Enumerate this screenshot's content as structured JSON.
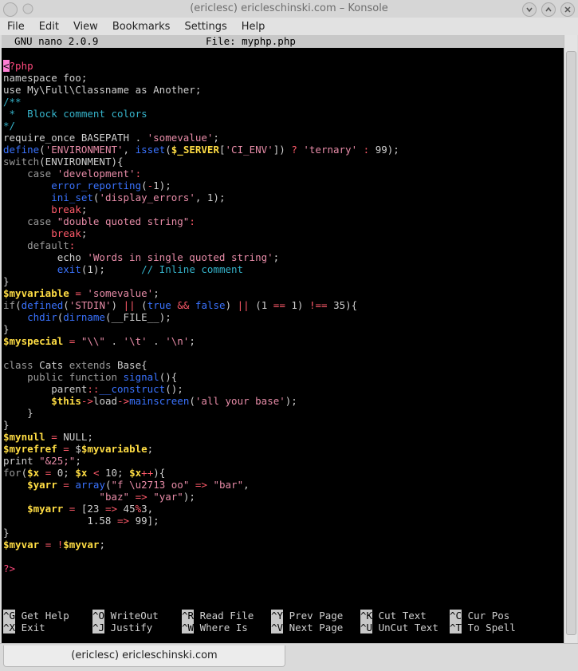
{
  "window": {
    "title": "(ericlesc) ericleschinski.com – Konsole"
  },
  "menu": [
    "File",
    "Edit",
    "View",
    "Bookmarks",
    "Settings",
    "Help"
  ],
  "nano": {
    "version": "GNU nano 2.0.9",
    "file": "File: myphp.php"
  },
  "help_rows": [
    [
      {
        "key": "^G",
        "label": "Get Help"
      },
      {
        "key": "^O",
        "label": "WriteOut"
      },
      {
        "key": "^R",
        "label": "Read File"
      },
      {
        "key": "^Y",
        "label": "Prev Page"
      },
      {
        "key": "^K",
        "label": "Cut Text"
      },
      {
        "key": "^C",
        "label": "Cur Pos"
      }
    ],
    [
      {
        "key": "^X",
        "label": "Exit"
      },
      {
        "key": "^J",
        "label": "Justify"
      },
      {
        "key": "^W",
        "label": "Where Is"
      },
      {
        "key": "^V",
        "label": "Next Page"
      },
      {
        "key": "^U",
        "label": "UnCut Text"
      },
      {
        "key": "^T",
        "label": "To Spell"
      }
    ]
  ],
  "tab": {
    "label": "(ericlesc) ericleschinski.com"
  },
  "code_lines": [
    [
      [
        "cursor",
        "<"
      ],
      [
        "k",
        "?php"
      ]
    ],
    [
      [
        "t",
        "namespace foo;"
      ]
    ],
    [
      [
        "t",
        "use My\\Full\\Classname as Another;"
      ]
    ],
    [
      [
        "c",
        "/**"
      ]
    ],
    [
      [
        "c",
        " *  Block comment colors"
      ]
    ],
    [
      [
        "c",
        "*/"
      ]
    ],
    [
      [
        "t",
        "require_once BASEPATH . "
      ],
      [
        "s",
        "'somevalue'"
      ],
      [
        "t",
        ";"
      ]
    ],
    [
      [
        "f",
        "define"
      ],
      [
        "t",
        "("
      ],
      [
        "s",
        "'ENVIRONMENT'"
      ],
      [
        "t",
        ", "
      ],
      [
        "f",
        "isset"
      ],
      [
        "t",
        "("
      ],
      [
        "v",
        "$_SERVER"
      ],
      [
        "t",
        "["
      ],
      [
        "s",
        "'CI_ENV'"
      ],
      [
        "t",
        "]) "
      ],
      [
        "o",
        "?"
      ],
      [
        "t",
        " "
      ],
      [
        "s",
        "'ternary'"
      ],
      [
        "t",
        " "
      ],
      [
        "o",
        ":"
      ],
      [
        "t",
        " 99);"
      ]
    ],
    [
      [
        "kw",
        "switch"
      ],
      [
        "t",
        "(ENVIRONMENT){"
      ]
    ],
    [
      [
        "t",
        "    "
      ],
      [
        "kw",
        "case"
      ],
      [
        "t",
        " "
      ],
      [
        "s",
        "'development'"
      ],
      [
        "o",
        ":"
      ]
    ],
    [
      [
        "t",
        "        "
      ],
      [
        "f",
        "error_reporting"
      ],
      [
        "t",
        "("
      ],
      [
        "o",
        "-"
      ],
      [
        "t",
        "1);"
      ]
    ],
    [
      [
        "t",
        "        "
      ],
      [
        "f",
        "ini_set"
      ],
      [
        "t",
        "("
      ],
      [
        "s",
        "'display_errors'"
      ],
      [
        "t",
        ", 1);"
      ]
    ],
    [
      [
        "t",
        "        "
      ],
      [
        "br",
        "break"
      ],
      [
        "t",
        ";"
      ]
    ],
    [
      [
        "t",
        "    "
      ],
      [
        "kw",
        "case"
      ],
      [
        "t",
        " "
      ],
      [
        "s",
        "\"double quoted string\""
      ],
      [
        "o",
        ":"
      ]
    ],
    [
      [
        "t",
        "        "
      ],
      [
        "br",
        "break"
      ],
      [
        "t",
        ";"
      ]
    ],
    [
      [
        "t",
        "    "
      ],
      [
        "kw",
        "default"
      ],
      [
        "o",
        ":"
      ]
    ],
    [
      [
        "t",
        "         echo "
      ],
      [
        "s",
        "'Words in single quoted string'"
      ],
      [
        "t",
        ";"
      ]
    ],
    [
      [
        "t",
        "         "
      ],
      [
        "f",
        "exit"
      ],
      [
        "t",
        "(1);      "
      ],
      [
        "c",
        "// Inline comment"
      ]
    ],
    [
      [
        "t",
        "}"
      ]
    ],
    [
      [
        "v",
        "$myvariable"
      ],
      [
        "t",
        " "
      ],
      [
        "o",
        "="
      ],
      [
        "t",
        " "
      ],
      [
        "s",
        "'somevalue'"
      ],
      [
        "t",
        ";"
      ]
    ],
    [
      [
        "kw",
        "if"
      ],
      [
        "t",
        "("
      ],
      [
        "f",
        "defined"
      ],
      [
        "t",
        "("
      ],
      [
        "s",
        "'STDIN'"
      ],
      [
        "t",
        ") "
      ],
      [
        "o",
        "||"
      ],
      [
        "t",
        " ("
      ],
      [
        "f",
        "true"
      ],
      [
        "t",
        " "
      ],
      [
        "o",
        "&&"
      ],
      [
        "t",
        " "
      ],
      [
        "f",
        "false"
      ],
      [
        "t",
        ") "
      ],
      [
        "o",
        "||"
      ],
      [
        "t",
        " (1 "
      ],
      [
        "o",
        "=="
      ],
      [
        "t",
        " 1) "
      ],
      [
        "o",
        "!=="
      ],
      [
        "t",
        " 35){"
      ]
    ],
    [
      [
        "t",
        "    "
      ],
      [
        "f",
        "chdir"
      ],
      [
        "t",
        "("
      ],
      [
        "f",
        "dirname"
      ],
      [
        "t",
        "(__FILE__);"
      ]
    ],
    [
      [
        "t",
        "}"
      ]
    ],
    [
      [
        "v",
        "$myspecial"
      ],
      [
        "t",
        " "
      ],
      [
        "o",
        "="
      ],
      [
        "t",
        " "
      ],
      [
        "s",
        "\"\\\\\""
      ],
      [
        "t",
        " . "
      ],
      [
        "s",
        "'\\t'"
      ],
      [
        "t",
        " . "
      ],
      [
        "s",
        "'\\n'"
      ],
      [
        "t",
        ";"
      ]
    ],
    [
      [
        "t",
        ""
      ]
    ],
    [
      [
        "kw",
        "class"
      ],
      [
        "t",
        " Cats "
      ],
      [
        "kw",
        "extends"
      ],
      [
        "t",
        " Base{"
      ]
    ],
    [
      [
        "t",
        "    "
      ],
      [
        "kw",
        "public function"
      ],
      [
        "t",
        " "
      ],
      [
        "f",
        "signal"
      ],
      [
        "t",
        "(){"
      ]
    ],
    [
      [
        "t",
        "        parent"
      ],
      [
        "o",
        "::"
      ],
      [
        "f",
        "__construct"
      ],
      [
        "t",
        "();"
      ]
    ],
    [
      [
        "t",
        "        "
      ],
      [
        "v",
        "$this"
      ],
      [
        "o",
        "->"
      ],
      [
        "t",
        "load"
      ],
      [
        "o",
        "->"
      ],
      [
        "f",
        "mainscreen"
      ],
      [
        "t",
        "("
      ],
      [
        "s",
        "'all your base'"
      ],
      [
        "t",
        ");"
      ]
    ],
    [
      [
        "t",
        "    }"
      ]
    ],
    [
      [
        "t",
        "}"
      ]
    ],
    [
      [
        "v",
        "$mynull"
      ],
      [
        "t",
        " "
      ],
      [
        "o",
        "="
      ],
      [
        "t",
        " NULL;"
      ]
    ],
    [
      [
        "v",
        "$myrefref"
      ],
      [
        "t",
        " "
      ],
      [
        "o",
        "="
      ],
      [
        "t",
        " $"
      ],
      [
        "v",
        "$myvariable"
      ],
      [
        "t",
        ";"
      ]
    ],
    [
      [
        "t",
        "print "
      ],
      [
        "s",
        "\"&25;\""
      ],
      [
        "t",
        ";"
      ]
    ],
    [
      [
        "kw",
        "for"
      ],
      [
        "t",
        "("
      ],
      [
        "v",
        "$x"
      ],
      [
        "t",
        " "
      ],
      [
        "o",
        "="
      ],
      [
        "t",
        " 0; "
      ],
      [
        "v",
        "$x"
      ],
      [
        "t",
        " "
      ],
      [
        "o",
        "<"
      ],
      [
        "t",
        " 10; "
      ],
      [
        "v",
        "$x"
      ],
      [
        "o",
        "++"
      ],
      [
        "t",
        "){"
      ]
    ],
    [
      [
        "t",
        "    "
      ],
      [
        "v",
        "$yarr"
      ],
      [
        "t",
        " "
      ],
      [
        "o",
        "="
      ],
      [
        "t",
        " "
      ],
      [
        "f",
        "array"
      ],
      [
        "t",
        "("
      ],
      [
        "s",
        "\"f \\u2713 oo\""
      ],
      [
        "t",
        " "
      ],
      [
        "o",
        "=>"
      ],
      [
        "t",
        " "
      ],
      [
        "s",
        "\"bar\""
      ],
      [
        "t",
        ","
      ]
    ],
    [
      [
        "t",
        "                "
      ],
      [
        "s",
        "\"baz\""
      ],
      [
        "t",
        " "
      ],
      [
        "o",
        "=>"
      ],
      [
        "t",
        " "
      ],
      [
        "s",
        "\"yar\""
      ],
      [
        "t",
        ");"
      ]
    ],
    [
      [
        "t",
        "    "
      ],
      [
        "v",
        "$myarr"
      ],
      [
        "t",
        " "
      ],
      [
        "o",
        "="
      ],
      [
        "t",
        " [23 "
      ],
      [
        "o",
        "=>"
      ],
      [
        "t",
        " 45"
      ],
      [
        "o",
        "%"
      ],
      [
        "t",
        "3,"
      ]
    ],
    [
      [
        "t",
        "              1.58 "
      ],
      [
        "o",
        "=>"
      ],
      [
        "t",
        " 99];"
      ]
    ],
    [
      [
        "t",
        "}"
      ]
    ],
    [
      [
        "v",
        "$myvar"
      ],
      [
        "t",
        " "
      ],
      [
        "o",
        "="
      ],
      [
        "t",
        " "
      ],
      [
        "o",
        "!"
      ],
      [
        "v",
        "$myvar"
      ],
      [
        "t",
        ";"
      ]
    ],
    [
      [
        "t",
        ""
      ]
    ],
    [
      [
        "k",
        "?>"
      ]
    ]
  ]
}
